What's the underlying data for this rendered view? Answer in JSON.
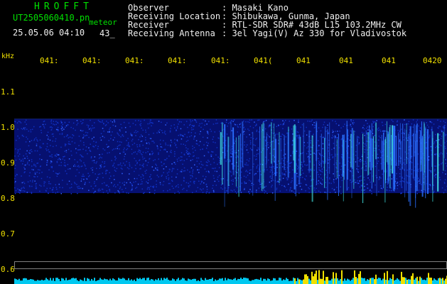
{
  "header": {
    "brand": "HROFFT",
    "filename": "UT2505060410.pn",
    "meteor_label": "meteor",
    "timestamp": "25.05.06 04:10",
    "count": "43_"
  },
  "meta": {
    "rows": [
      {
        "label": "Observer",
        "value": ": Masaki Kano"
      },
      {
        "label": "Receiving Location",
        "value": ": Shibukawa, Gunma, Japan"
      },
      {
        "label": "Receiver",
        "value": ": RTL-SDR SDR# 43dB L15 103.2MHz CW"
      },
      {
        "label": "Receiving Antenna",
        "value": ": 3el Yagi(V) Az 330 for Vladivostok"
      }
    ]
  },
  "axis": {
    "unit": "kHz",
    "y_ticks": [
      "1.1",
      "1.0",
      "0.9",
      "0.8",
      "0.7",
      "0.6"
    ],
    "x_ticks": [
      "041:",
      "041:",
      "041:",
      "041:",
      "041:",
      "041(",
      "041",
      "041",
      "041",
      "0420"
    ]
  },
  "colors": {
    "accent_green": "#00e000",
    "tick_yellow": "#f0e000",
    "noise_blue": "#1030c0",
    "echo_cyan": "#40e0e0",
    "baseline_cyan": "#00c8f0"
  }
}
